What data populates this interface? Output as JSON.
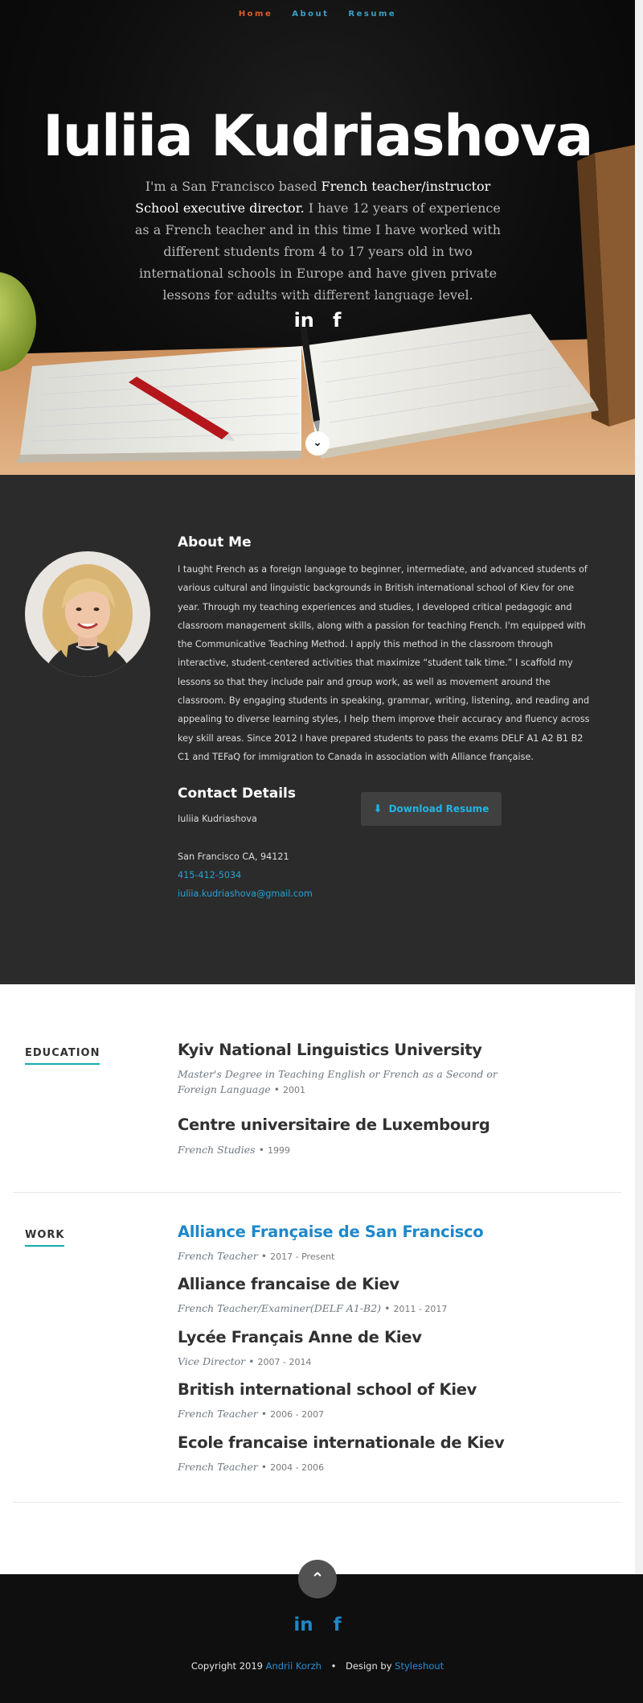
{
  "nav": {
    "items": [
      "Home",
      "About",
      "Resume"
    ],
    "active": "Home"
  },
  "hero": {
    "name": "Iuliia Kudriashova",
    "intro_part1": "I'm a San Francisco based ",
    "intro_highlight": "French teacher/instructor School executive director.",
    "intro_part2": " I have 12 years of experience as a French teacher and in this time I have worked with different students from 4 to 17 years old in two international schools in Europe and have given private lessons for adults with different language level.",
    "social": [
      "in",
      "f"
    ]
  },
  "about": {
    "title": "About Me",
    "text": "I taught French as a foreign language to beginner, intermediate, and advanced students of various cultural and linguistic backgrounds in British international school of Kiev for one year. Through my teaching experiences and studies, I developed critical pedagogic and classroom management skills, along with a passion for teaching French. I'm equipped with the Communicative Teaching Method. I apply this method in the classroom through interactive, student-centered activities that maximize “student talk time.” I scaffold my lessons so that they include pair and group work, as well as movement around the classroom. By engaging students in speaking, grammar, writing, listening, and reading and appealing to diverse learning styles, I help them improve their accuracy and fluency across key skill areas. Since 2012 I have prepared students to pass the exams DELF A1 A2 B1 B2 C1 and TEFaQ for immigration to Canada in association with Alliance française.",
    "contact_title": "Contact Details",
    "contact_name": "Iuliia Kudriashova",
    "contact_address": "San Francisco CA, 94121",
    "contact_phone": "415-412-5034",
    "contact_email": "iuliia.kudriashova@gmail.com",
    "download_label": "Download Resume"
  },
  "education": {
    "label": "EDUCATION",
    "entries": [
      {
        "title": "Kyiv National Linguistics University",
        "meta": "Master's Degree in Teaching English or French as a Second or Foreign Language",
        "date": "2001"
      },
      {
        "title": "Centre universitaire de Luxembourg",
        "meta": "French Studies",
        "date": "1999"
      }
    ]
  },
  "work": {
    "label": "WORK",
    "entries": [
      {
        "title": "Alliance Française de San Francisco",
        "meta": "French Teacher",
        "date": "2017 - Present"
      },
      {
        "title": "Alliance francaise de Kiev",
        "meta": "French Teacher/Examiner(DELF A1-B2)",
        "date": "2011 - 2017"
      },
      {
        "title": "Lycée Français Anne de Kiev",
        "meta": "Vice Director",
        "date": "2007 - 2014"
      },
      {
        "title": "British international school of Kiev",
        "meta": "French Teacher",
        "date": "2006 - 2007"
      },
      {
        "title": "Ecole francaise internationale de Kiev",
        "meta": "French Teacher",
        "date": "2004 - 2006"
      }
    ]
  },
  "footer": {
    "social": [
      "in",
      "f"
    ],
    "copyright_prefix": "Copyright 2019",
    "author": "Andrii Korzh",
    "design_prefix": "Design by",
    "designer": "Styleshout"
  },
  "icons": {
    "scroll_down": "chevron-down-icon",
    "go_top": "chevron-up-icon",
    "download": "download-icon",
    "linkedin": "linkedin-icon",
    "facebook": "facebook-icon"
  },
  "colors": {
    "nav_active": "#d95e2b",
    "nav_link": "#3d9fc1",
    "accent_teal": "#11abb0",
    "link_blue": "#1e88c9",
    "about_bg": "#2b2b2b",
    "footer_bg": "#0f0f0f"
  }
}
